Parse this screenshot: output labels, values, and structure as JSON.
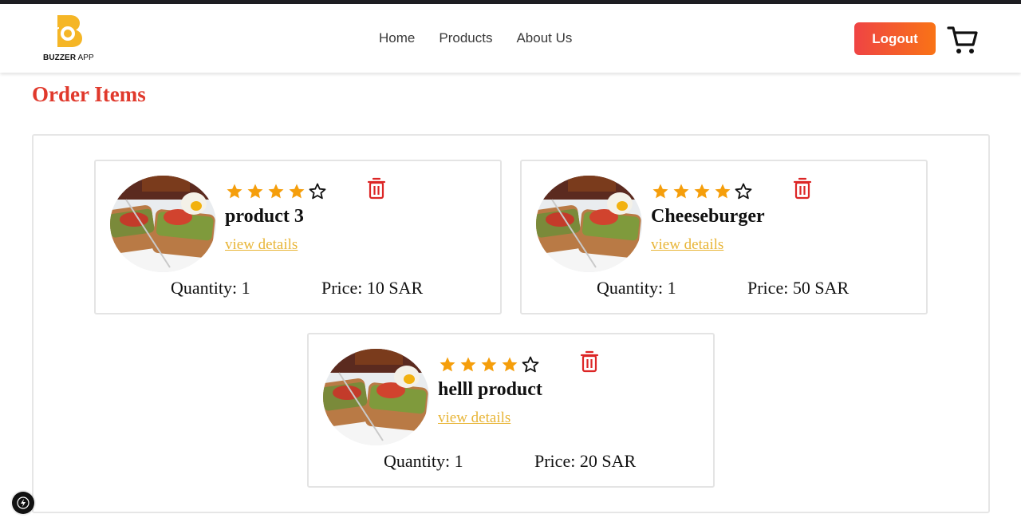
{
  "brand": {
    "name_bold": "BUZZER",
    "name_light": " APP",
    "logo_icon": "buzzer-logo-icon",
    "logo_color": "#f5b626"
  },
  "nav": {
    "links": [
      "Home",
      "Products",
      "About Us"
    ],
    "logout_label": "Logout",
    "cart_icon": "cart-icon"
  },
  "page": {
    "title": "Order Items"
  },
  "colors": {
    "accent_red": "#e0392c",
    "button_gradient_start": "#ef4444",
    "button_gradient_end": "#f97316",
    "star_filled": "#f59e0b",
    "link_gold": "#e8b537",
    "trash_red": "#dc2626"
  },
  "orders": [
    {
      "name": "product 3",
      "rating": 4,
      "rating_max": 5,
      "details_label": "view details",
      "quantity": "Quantity: 1",
      "price": "Price: 10 SAR",
      "image_icon": "food-photo"
    },
    {
      "name": "Cheeseburger",
      "rating": 4,
      "rating_max": 5,
      "details_label": "view details",
      "quantity": "Quantity: 1",
      "price": "Price: 50 SAR",
      "image_icon": "food-photo"
    },
    {
      "name": "helll product",
      "rating": 4,
      "rating_max": 5,
      "details_label": "view details",
      "quantity": "Quantity: 1",
      "price": "Price: 20 SAR",
      "image_icon": "food-photo"
    }
  ]
}
